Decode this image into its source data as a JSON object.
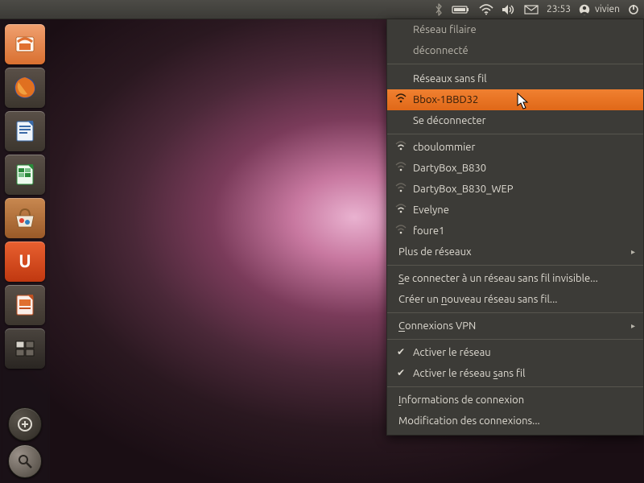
{
  "panel": {
    "time": "23:53",
    "user": "vivien"
  },
  "launcher": {
    "items": [
      {
        "name": "files"
      },
      {
        "name": "firefox"
      },
      {
        "name": "writer"
      },
      {
        "name": "calc"
      },
      {
        "name": "software-center"
      },
      {
        "name": "ubuntu-one"
      },
      {
        "name": "impress"
      },
      {
        "name": "workspace-switcher"
      }
    ]
  },
  "network_menu": {
    "wired_header": "Réseau filaire",
    "wired_status": "déconnecté",
    "wireless_header": "Réseaux sans fil",
    "connected_ssid": "Bbox-1BBD32",
    "disconnect": "Se déconnecter",
    "other_networks": [
      "cboulommier",
      "DartyBox_B830",
      "DartyBox_B830_WEP",
      "Evelyne",
      "foure1"
    ],
    "more_networks": "Plus de réseaux",
    "hidden": "Se connecter à un réseau sans fil invisible...",
    "create": "Créer un nouveau réseau sans fil...",
    "vpn": "Connexions VPN",
    "enable_net": "Activer le réseau",
    "enable_wifi": "Activer le réseau sans fil",
    "info": "Informations de connexion",
    "edit": "Modification des connexions...",
    "mn": {
      "hidden": "S",
      "create": "n",
      "vpn": "C",
      "wifi_sans": "s",
      "info": "I"
    }
  }
}
